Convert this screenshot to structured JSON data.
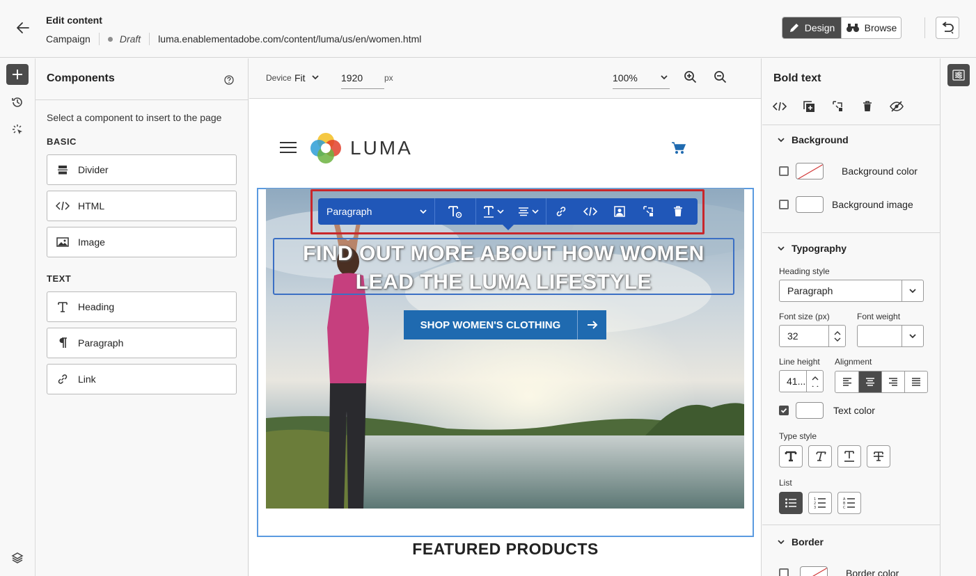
{
  "header": {
    "title": "Edit content",
    "channel": "Campaign",
    "status": "Draft",
    "url": "luma.enablementadobe.com/content/luma/us/en/women.html",
    "design_label": "Design",
    "browse_label": "Browse"
  },
  "components_panel": {
    "title": "Components",
    "description": "Select a component to insert to the page",
    "basic_label": "BASIC",
    "basic_items": [
      {
        "label": "Divider",
        "icon": "divider-icon"
      },
      {
        "label": "HTML",
        "icon": "code-icon"
      },
      {
        "label": "Image",
        "icon": "image-icon"
      }
    ],
    "text_label": "TEXT",
    "text_items": [
      {
        "label": "Heading",
        "icon": "heading-icon"
      },
      {
        "label": "Paragraph",
        "icon": "paragraph-icon"
      },
      {
        "label": "Link",
        "icon": "link-icon"
      }
    ]
  },
  "canvas_toolbar": {
    "device_label": "Device",
    "device_value": "Fit",
    "width_value": "1920",
    "width_unit": "px",
    "zoom_value": "100%"
  },
  "page": {
    "logo_text": "LUMA",
    "headline": "FIND OUT MORE ABOUT HOW WOMEN LEAD THE LUMA LIFESTYLE",
    "cta_label": "SHOP WOMEN'S CLOTHING",
    "featured_heading": "FEATURED PRODUCTS"
  },
  "rich_text_toolbar": {
    "style_value": "Paragraph"
  },
  "properties": {
    "title": "Bold text",
    "background": {
      "heading": "Background",
      "color_label": "Background color",
      "image_label": "Background image"
    },
    "typography": {
      "heading": "Typography",
      "heading_style_label": "Heading style",
      "heading_style_value": "Paragraph",
      "font_size_label": "Font size (px)",
      "font_size_value": "32",
      "font_weight_label": "Font weight",
      "font_weight_value": "",
      "line_height_label": "Line height",
      "line_height_value": "41...",
      "alignment_label": "Alignment",
      "alignment_selected": "center",
      "text_color_label": "Text color",
      "text_color_checked": true,
      "type_style_label": "Type style",
      "list_label": "List",
      "list_selected": "bullet"
    },
    "border": {
      "heading": "Border",
      "color_label": "Border color"
    }
  },
  "colors": {
    "accent_blue": "#2057b8",
    "selection_outline": "#3b6fc4",
    "highlight_red": "#c8262b",
    "cta_blue": "#1f6ab0",
    "dark_button": "#4b4b4b"
  }
}
